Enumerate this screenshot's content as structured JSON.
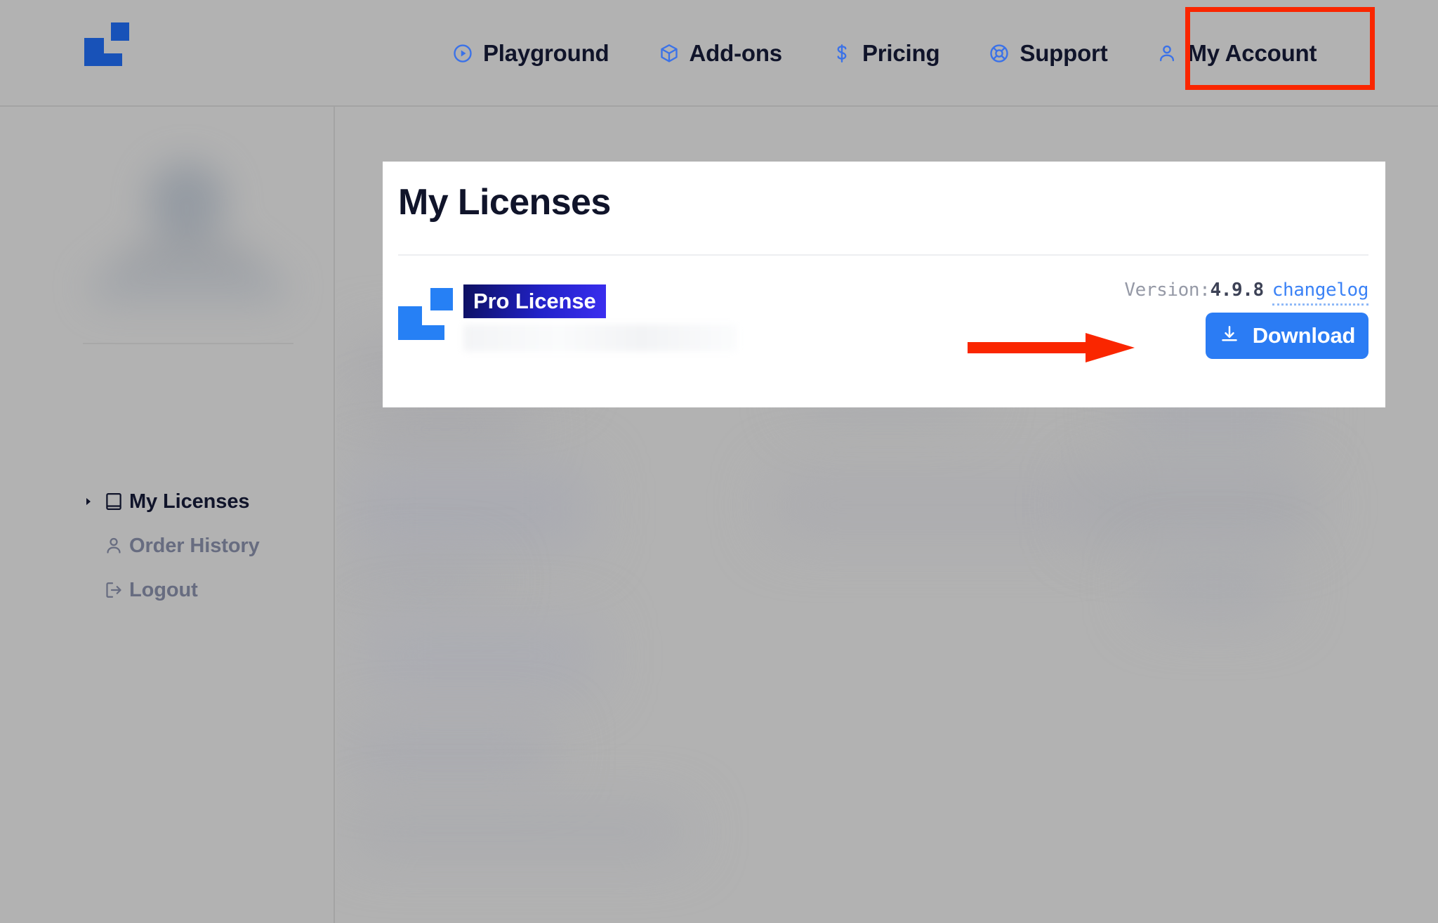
{
  "header": {
    "logo_name": "brand-logo",
    "logo_color": "#1852b8",
    "nav": [
      {
        "label": "Playground",
        "icon": "play-circle-icon"
      },
      {
        "label": "Add-ons",
        "icon": "cube-icon"
      },
      {
        "label": "Pricing",
        "icon": "dollar-icon"
      },
      {
        "label": "Support",
        "icon": "lifebuoy-icon"
      },
      {
        "label": "My Account",
        "icon": "user-icon"
      }
    ],
    "icon_color": "#3b72e8",
    "label_color": "#10142a"
  },
  "annotations": {
    "account_highlight_color": "#fa2600",
    "download_arrow_color": "#fa2600"
  },
  "sidebar": {
    "items": [
      {
        "label": "My Licenses",
        "icon": "book-icon",
        "caret": "▸",
        "active": true
      },
      {
        "label": "Order History",
        "icon": "user-icon",
        "caret": "",
        "active": false
      },
      {
        "label": "Logout",
        "icon": "logout-icon",
        "caret": "",
        "active": false
      }
    ],
    "active_color": "#10142a",
    "inactive_color": "#676c80"
  },
  "card": {
    "title": "My Licenses",
    "license": {
      "logo_name": "product-logo",
      "logo_color": "#2680f5",
      "badge_label": "Pro License",
      "badge_gradient_from": "#0d1060",
      "badge_gradient_to": "#3b2ef0",
      "key_redacted": true,
      "version_label": "Version:",
      "version_number": "4.9.8",
      "changelog_label": "changelog",
      "changelog_color": "#3b82f6",
      "download_label": "Download",
      "download_icon": "download-icon",
      "download_color": "#2b7cf4"
    }
  }
}
